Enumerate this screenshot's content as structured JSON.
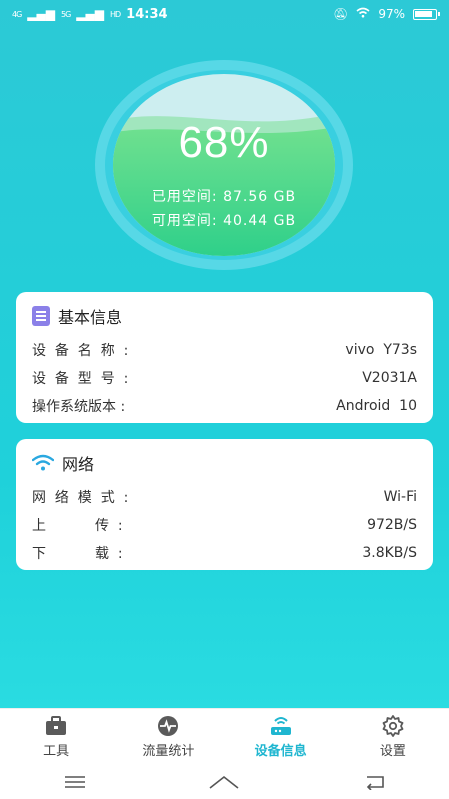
{
  "status_bar": {
    "network1": "4G",
    "network2": "5G",
    "hd": "HD",
    "time": "14:34",
    "battery_text": "97%"
  },
  "gauge": {
    "percent_text": "68%",
    "percent": 68,
    "used_label": "已用空间:",
    "used_value": "87.56  GB",
    "free_label": "可用空间:",
    "free_value": "40.44  GB"
  },
  "basic_info": {
    "title": "基本信息",
    "rows": [
      {
        "label": "设  备  名  称  :",
        "value": "vivo  Y73s"
      },
      {
        "label": "设  备  型  号  :",
        "value": "V2031A"
      },
      {
        "label": "操作系统版本 :",
        "value": "Android  10"
      }
    ]
  },
  "network": {
    "title": "网络",
    "rows": [
      {
        "label": "网  络  模  式  :",
        "value": "Wi-Fi"
      },
      {
        "label": "上           传  :",
        "value": "972B/S"
      },
      {
        "label": "下           载  :",
        "value": "3.8KB/S"
      }
    ]
  },
  "tabs": [
    {
      "label": "工具",
      "icon": "toolbox-icon",
      "active": false
    },
    {
      "label": "流量统计",
      "icon": "pulse-icon",
      "active": false
    },
    {
      "label": "设备信息",
      "icon": "router-icon",
      "active": true
    },
    {
      "label": "设置",
      "icon": "gear-icon",
      "active": false
    }
  ],
  "colors": {
    "accent": "#1fb6d0",
    "gauge_green": "#3dd38a",
    "card_bg": "#ffffff"
  }
}
